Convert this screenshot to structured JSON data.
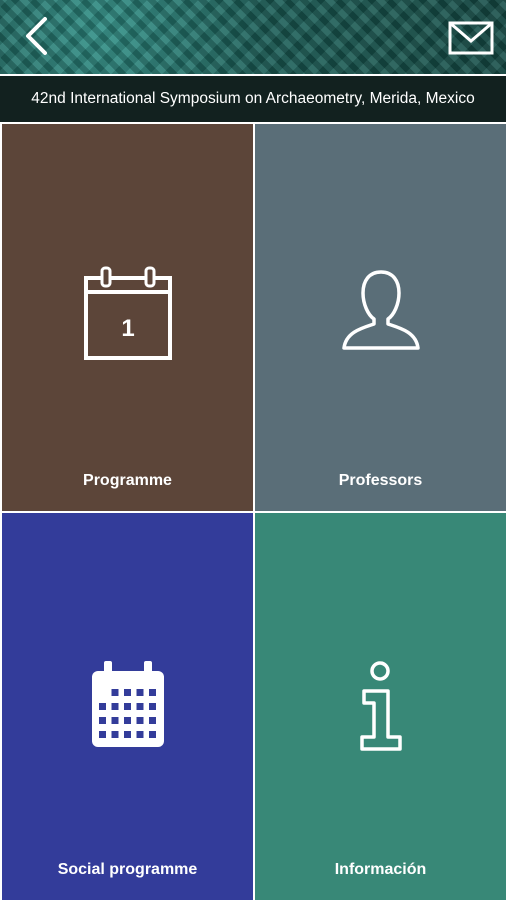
{
  "header": {
    "back_icon": "chevron-left-icon",
    "mail_icon": "envelope-icon"
  },
  "event_title": "42nd International Symposium on Archaeometry, Merida, Mexico",
  "tiles": [
    {
      "label": "Programme",
      "icon": "calendar-day-icon",
      "day_number": "1",
      "color": "#5c4539"
    },
    {
      "label": "Professors",
      "icon": "person-silhouette-icon",
      "color": "#5a6e78"
    },
    {
      "label": "Social programme",
      "icon": "calendar-grid-icon",
      "color": "#333c9a"
    },
    {
      "label": "Información",
      "icon": "info-icon",
      "color": "#388877"
    }
  ]
}
